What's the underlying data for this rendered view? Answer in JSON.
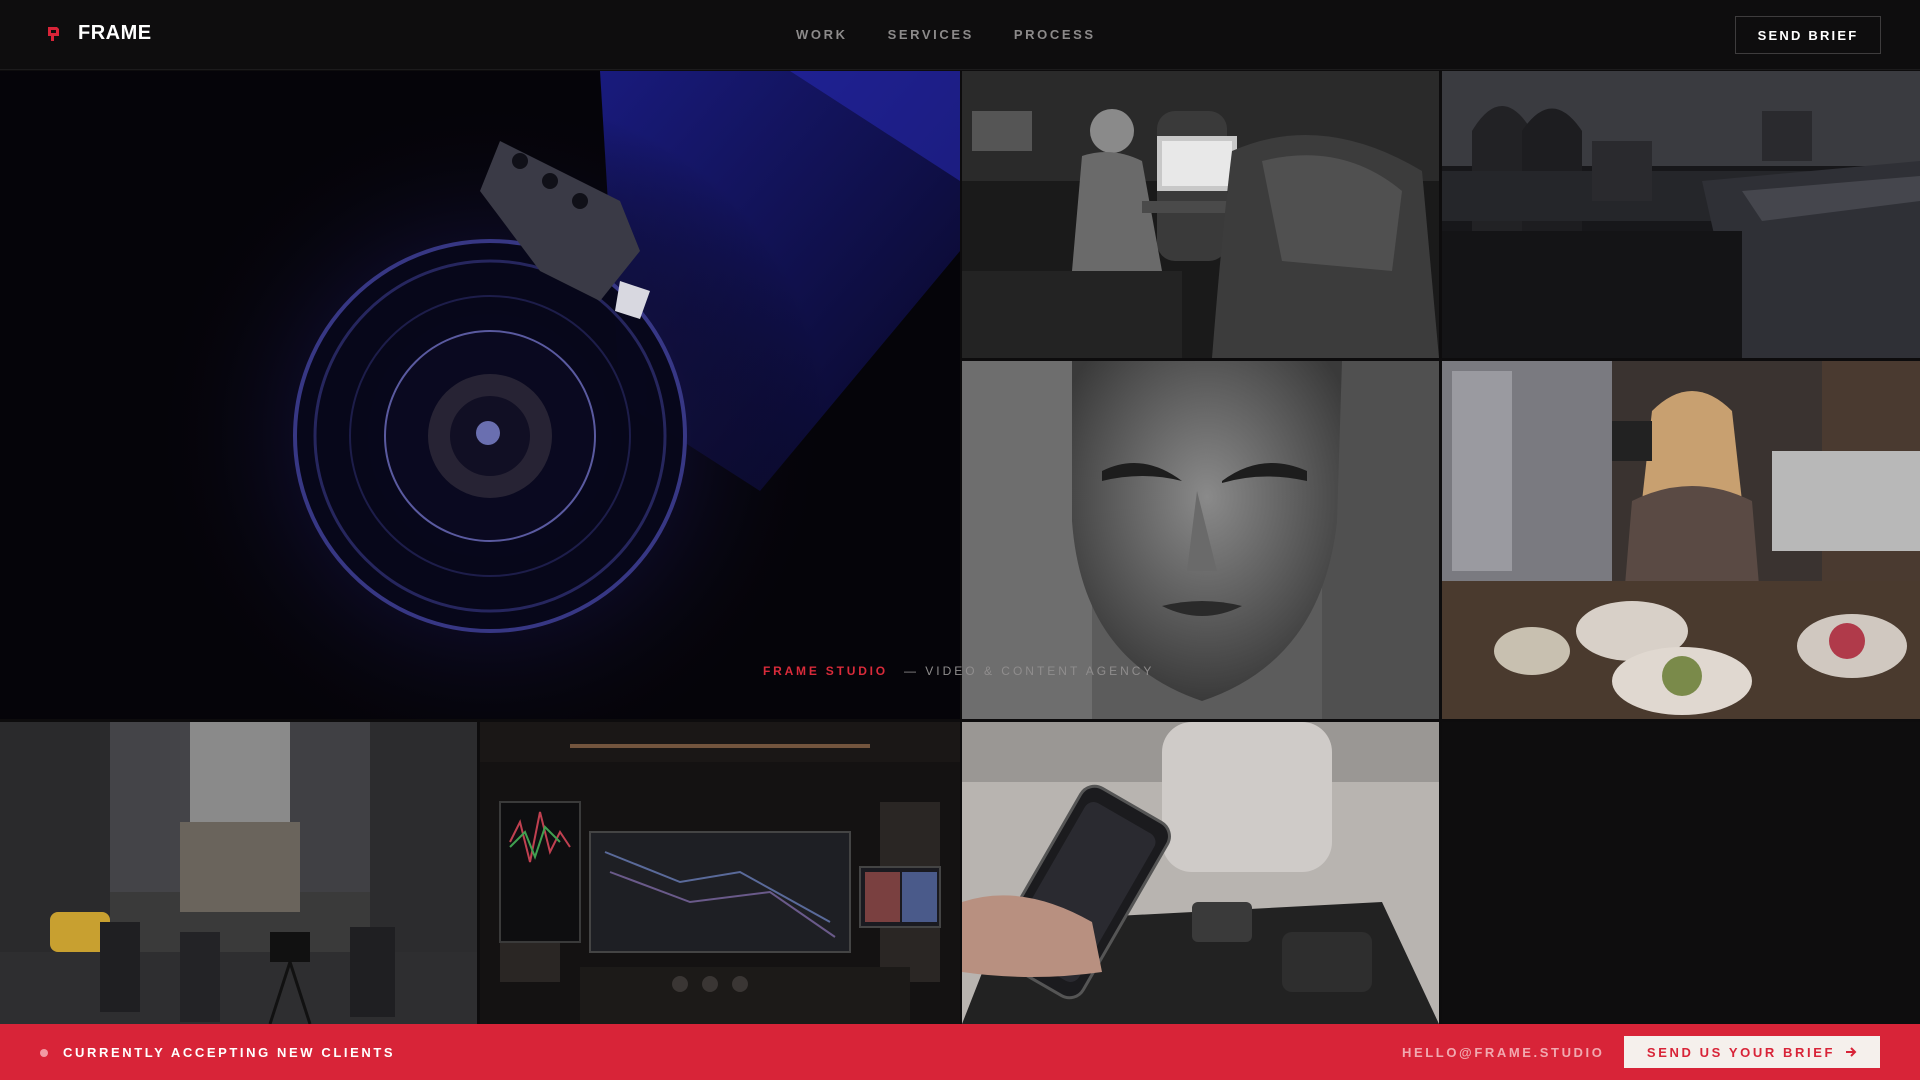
{
  "brand": {
    "name": "FRAME",
    "accent": "#d82438",
    "logo_icon": "film-frame-icon"
  },
  "nav": {
    "items": [
      {
        "label": "WORK"
      },
      {
        "label": "SERVICES"
      },
      {
        "label": "PROCESS"
      }
    ],
    "cta_label": "SEND BRIEF"
  },
  "gallery": {
    "tiles": [
      {
        "subject": "camera-lens-image"
      },
      {
        "subject": "editor-at-desk-image"
      },
      {
        "subject": "city-rooftop-image"
      },
      {
        "subject": "sculpted-face-image"
      },
      {
        "subject": "cafe-creator-image"
      },
      {
        "subject": "city-street-image"
      },
      {
        "subject": "editing-suite-image"
      },
      {
        "subject": "phone-gimbal-image"
      }
    ]
  },
  "tagline": {
    "brand": "FRAME STUDIO",
    "description": "— VIDEO & CONTENT AGENCY"
  },
  "footer_bar": {
    "status": "CURRENTLY ACCEPTING NEW CLIENTS",
    "email": "HELLO@FRAME.STUDIO",
    "cta_label": "SEND US YOUR BRIEF",
    "cta_icon": "arrow-right-icon"
  }
}
